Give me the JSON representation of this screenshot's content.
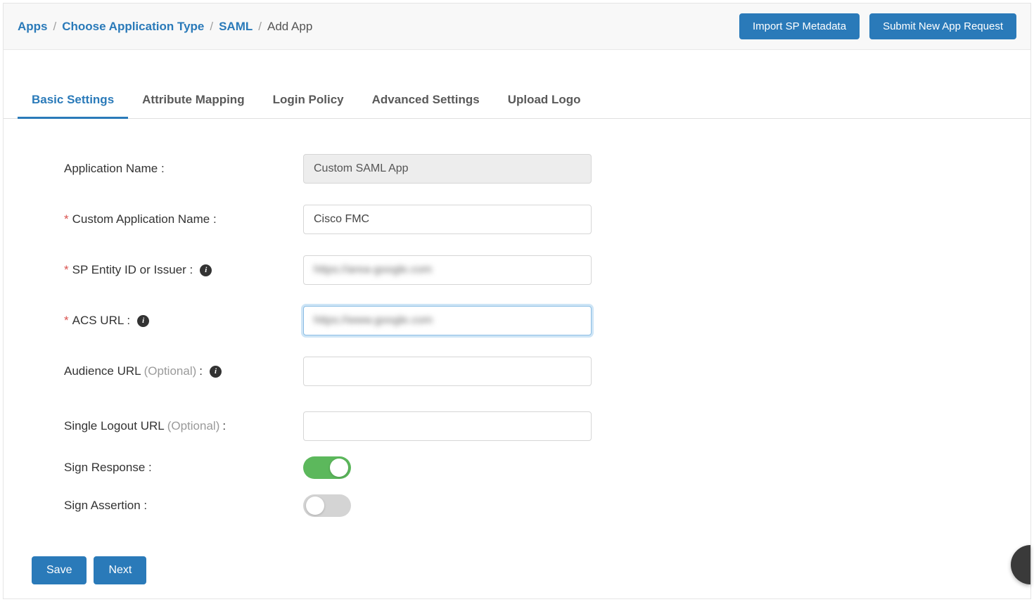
{
  "breadcrumb": {
    "apps": "Apps",
    "choose_type": "Choose Application Type",
    "saml": "SAML",
    "add_app": "Add App"
  },
  "top_buttons": {
    "import_metadata": "Import SP Metadata",
    "submit_request": "Submit New App Request"
  },
  "tabs": {
    "basic": "Basic Settings",
    "attribute": "Attribute Mapping",
    "login": "Login Policy",
    "advanced": "Advanced Settings",
    "upload": "Upload Logo"
  },
  "form": {
    "app_name_label": "Application Name :",
    "app_name_value": "Custom SAML App",
    "custom_name_label": "Custom Application Name :",
    "custom_name_value": "Cisco FMC",
    "sp_entity_label": "SP Entity ID or Issuer :",
    "sp_entity_value": "https://area-google.com",
    "acs_url_label": "ACS URL :",
    "acs_url_value": "https://www.google.com",
    "audience_label": "Audience URL ",
    "audience_optional": "(Optional) ",
    "audience_colon": ":",
    "audience_value": "",
    "slo_label": "Single Logout URL ",
    "slo_optional": "(Optional) ",
    "slo_colon": ":",
    "slo_value": "",
    "sign_response_label": "Sign Response :",
    "sign_assertion_label": "Sign Assertion :",
    "sign_response_on": true,
    "sign_assertion_on": false
  },
  "footer": {
    "save": "Save",
    "next": "Next"
  },
  "info_glyph": "i"
}
